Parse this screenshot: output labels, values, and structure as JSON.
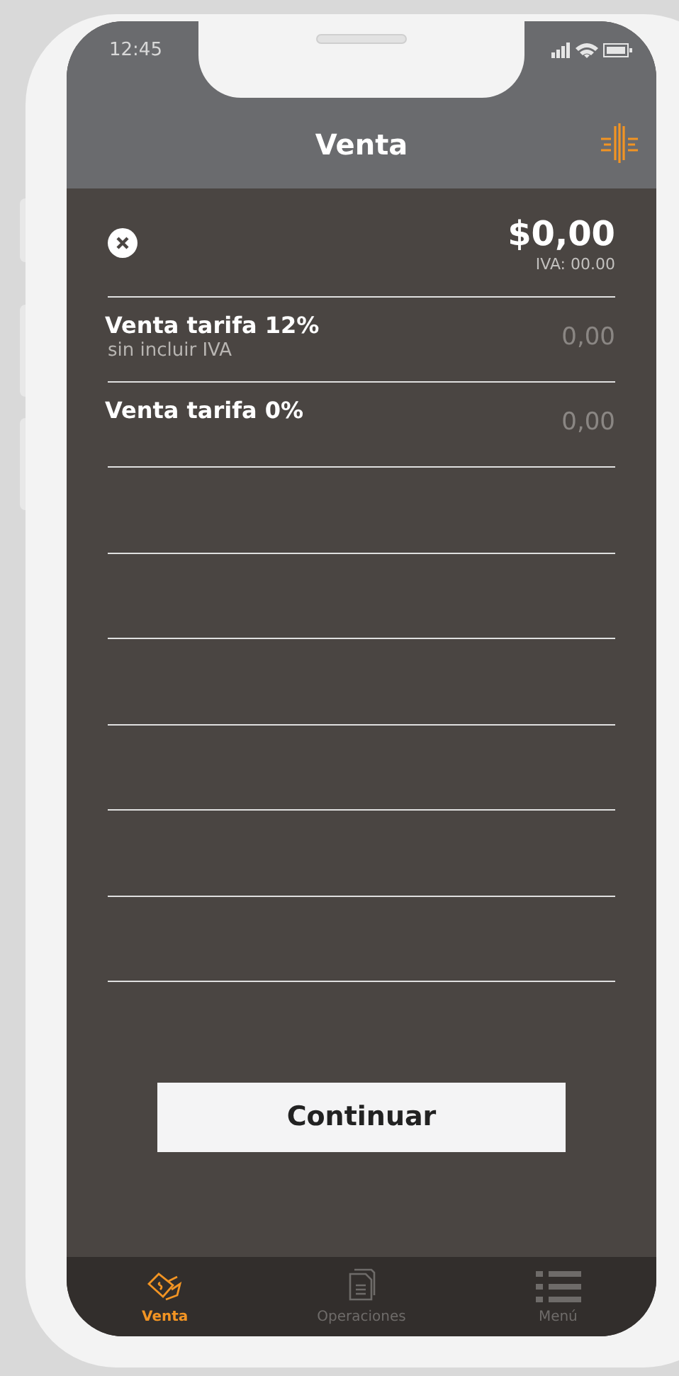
{
  "status_bar": {
    "time": "12:45"
  },
  "header": {
    "title": "Venta"
  },
  "summary": {
    "total": "$0,00",
    "tax": "IVA: 00.00"
  },
  "rows": [
    {
      "label": "Venta tarifa 12%",
      "sublabel": "sin incluir IVA",
      "value": "0,00"
    },
    {
      "label": "Venta tarifa 0%",
      "value": "0,00"
    }
  ],
  "continue_button": "Continuar",
  "tabs": [
    {
      "kind": "sale",
      "label": "Venta",
      "selected": true
    },
    {
      "kind": "documents",
      "label": "Operaciones",
      "selected": false
    },
    {
      "kind": "menu",
      "label": "Menú",
      "selected": false
    }
  ]
}
